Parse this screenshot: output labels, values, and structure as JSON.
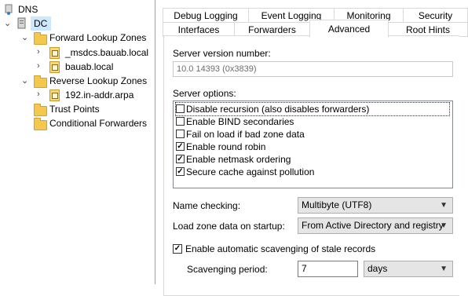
{
  "tree": {
    "root": {
      "label": "DNS",
      "icon": "dns-icon"
    },
    "server": {
      "label": "DC",
      "icon": "server-icon"
    },
    "forward_zones": {
      "label": "Forward Lookup Zones"
    },
    "zone1": {
      "label": "_msdcs.bauab.local"
    },
    "zone2": {
      "label": "bauab.local"
    },
    "reverse_zones": {
      "label": "Reverse Lookup Zones"
    },
    "zone3": {
      "label": "192.in-addr.arpa"
    },
    "trust_points": {
      "label": "Trust Points"
    },
    "conditional_forwarders": {
      "label": "Conditional Forwarders"
    }
  },
  "tabs": {
    "row1": [
      "Debug Logging",
      "Event Logging",
      "Monitoring",
      "Security"
    ],
    "row2": [
      "Interfaces",
      "Forwarders",
      "Advanced",
      "Root Hints"
    ],
    "active": "Advanced"
  },
  "advanced": {
    "version_label": "Server version number:",
    "version_value": "10.0 14393 (0x3839)",
    "options_label": "Server options:",
    "options": [
      {
        "label": "Disable recursion (also disables forwarders)",
        "checked": false
      },
      {
        "label": "Enable BIND secondaries",
        "checked": false
      },
      {
        "label": "Fail on load if bad zone data",
        "checked": false
      },
      {
        "label": "Enable round robin",
        "checked": true
      },
      {
        "label": "Enable netmask ordering",
        "checked": true
      },
      {
        "label": "Secure cache against pollution",
        "checked": true
      }
    ],
    "name_checking_label": "Name checking:",
    "name_checking_value": "Multibyte (UTF8)",
    "load_zone_label": "Load zone data on startup:",
    "load_zone_value": "From Active Directory and registry",
    "scavenging_checkbox_label": "Enable automatic scavenging of stale records",
    "scavenging_checked": true,
    "scavenging_period_label": "Scavenging period:",
    "scavenging_period_value": "7",
    "scavenging_unit": "days"
  }
}
